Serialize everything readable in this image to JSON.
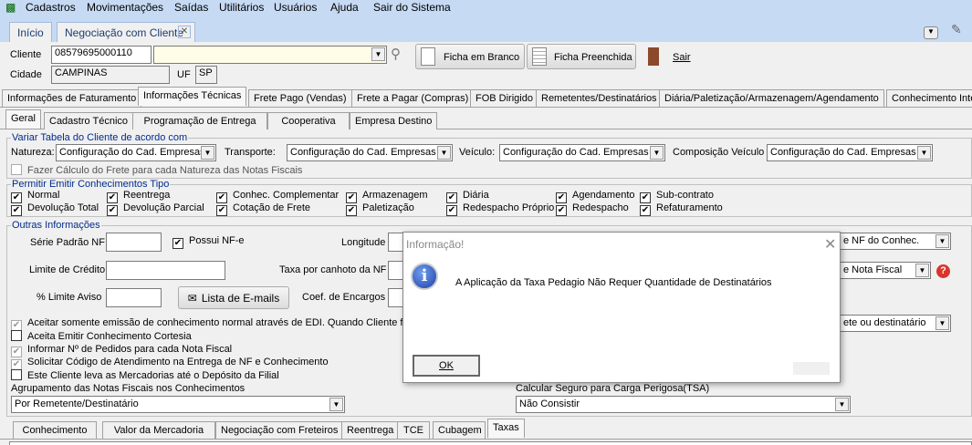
{
  "menu": [
    "Cadastros",
    "Movimentações",
    "Saídas",
    "Utilitários",
    "Usuários",
    "Ajuda",
    "Sair do Sistema"
  ],
  "doc_tabs": [
    {
      "label": "Início"
    },
    {
      "label": "Negociação com Cliente"
    }
  ],
  "header": {
    "cliente_label": "Cliente",
    "cliente_value": "08579695000110",
    "cliente_name": "",
    "cidade_label": "Cidade",
    "cidade_value": "CAMPINAS",
    "uf_label": "UF",
    "uf_value": "SP",
    "ficha_branco": "Ficha em Branco",
    "ficha_preenchida": "Ficha Preenchida",
    "sair": "Sair"
  },
  "main_tabs": [
    "Informações de Faturamento",
    "Informações Técnicas",
    "Frete Pago (Vendas)",
    "Frete a Pagar (Compras)",
    "FOB Dirigido",
    "Remetentes/Destinatários",
    "Diária/Paletização/Armazenagem/Agendamento",
    "Conhecimento Inte"
  ],
  "sub_tabs": [
    "Geral",
    "Cadastro Técnico",
    "Programação de Entrega",
    "Cooperativa",
    "Empresa Destino"
  ],
  "variar": {
    "title": "Variar Tabela do Cliente de acordo com",
    "natureza_label": "Natureza:",
    "natureza": "Configuração do Cad. Empresas",
    "transporte_label": "Transporte:",
    "transporte": "Configuração do Cad. Empresas",
    "veiculo_label": "Veículo:",
    "veiculo": "Configuração do Cad. Empresas",
    "composicao_label": "Composição Veículo",
    "composicao": "Configuração do Cad. Empresas",
    "fazer_calculo": "Fazer Cálculo do Frete para cada Natureza das Notas Fiscais"
  },
  "permitir": {
    "title": "Permitir Emitir Conhecimentos Tipo",
    "items": [
      "Normal",
      "Reentrega",
      "Conhec. Complementar",
      "Armazenagem",
      "Diária",
      "Agendamento",
      "Sub-contrato",
      "Devolução Total",
      "Devolução Parcial",
      "Cotação de Frete",
      "Paletização",
      "Redespacho Próprio",
      "Redespacho",
      "Refaturamento"
    ]
  },
  "outras": {
    "title": "Outras Informações",
    "serie_label": "Série Padrão NF",
    "possui_nfe": "Possui NF-e",
    "longitude_label": "Longitude",
    "limite_label": "Limite de Crédito",
    "taxa_canhoto_label": "Taxa por canhoto da NF",
    "pct_limite_label": "% Limite Aviso",
    "lista_emails": "Lista de E-mails",
    "coef_label": "Coef. de Encargos",
    "sel1": "e NF do Conhec.",
    "sel2": "e Nota Fiscal",
    "sel3": "ete ou destinatário",
    "checks": [
      "Aceitar somente emissão de conhecimento normal através de EDI. Quando Cliente for",
      "Aceita Emitir Conhecimento Cortesia",
      "Informar Nº de Pedidos para cada Nota Fiscal",
      "Solicitar Código de Atendimento na Entrega de NF e Conhecimento",
      "Este Cliente leva as Mercadorias até o Depósito da Filial"
    ],
    "agrup_label": "Agrupamento das Notas Fiscais nos Conhecimentos",
    "agrup_value": "Por Remetente/Destinatário",
    "seguro_label": "Calcular Seguro para Carga Perigosa(TSA)",
    "seguro_value": "Não Consistir"
  },
  "bottom_tabs": [
    "Conhecimento",
    "Valor da Mercadoria",
    "Negociação com Freteiros",
    "Reentrega",
    "TCE",
    "Cubagem",
    "Taxas"
  ],
  "dialog": {
    "title": "Informação!",
    "message": "A Aplicação da Taxa Pedagio  Não Requer Quantidade de Destinatários",
    "ok": "OK"
  }
}
